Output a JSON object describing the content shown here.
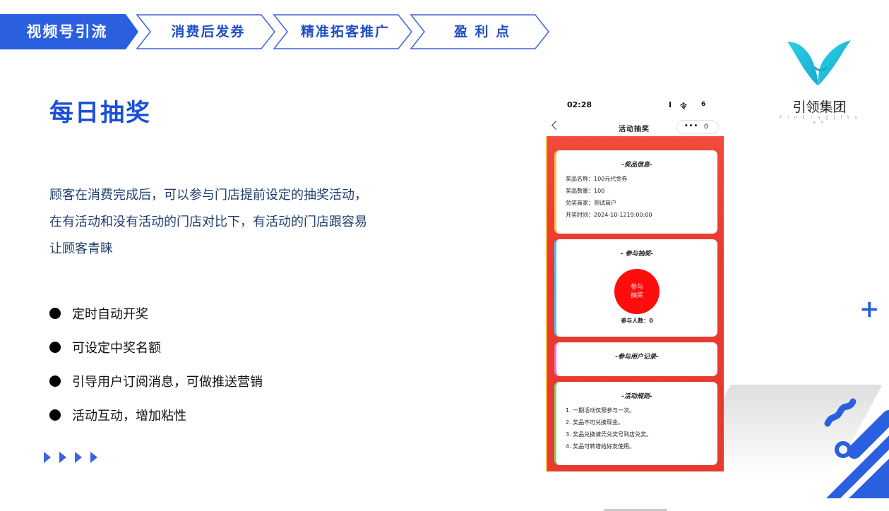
{
  "nav": {
    "steps": [
      {
        "label": "视频号引流",
        "active": true
      },
      {
        "label": "消费后发券",
        "active": false
      },
      {
        "label": "精准拓客推广",
        "active": false
      },
      {
        "label": "盈 利 点",
        "active": false
      }
    ]
  },
  "logo": {
    "name": "引领集团",
    "subtitle": "Y i n  L i n g  J i t u a n"
  },
  "content": {
    "title": "每日抽奖",
    "description": "顾客在消费完成后，可以参与门店提前设定的抽奖活动，在有活动和没有活动的门店对比下，有活动的门店跟容易让顾客青睐",
    "features": [
      "定时自动开奖",
      "可设定中奖名额",
      "引导用户订阅消息，可做推送营销",
      "活动互动，增加粘性"
    ]
  },
  "phone": {
    "status": {
      "time": "02:28",
      "battery": "6",
      "wifi": "令"
    },
    "appbar": {
      "title": "活动抽奖",
      "more": "•••",
      "close": "0"
    },
    "prize_card": {
      "title": "-奖品信息-",
      "lines": [
        "奖品名称：100元代金券",
        "奖品数量：100",
        "兑奖商家：测试商户",
        "开奖时间：2024-10-1219:00:00"
      ]
    },
    "join_card": {
      "title": "- 参与抽奖-",
      "button_line1": "参与",
      "button_line2": "抽奖",
      "participants": "参与人数：0"
    },
    "records_card": {
      "title": "-参与用户记录-"
    },
    "rules_card": {
      "title": "-活动规则-",
      "lines": [
        "1. 一期活动仅限参与一次。",
        "2. 奖品不可兑换现金。",
        "3. 奖品兑换请凭兑奖号到店兑奖。",
        "4. 奖品可转增给好友使用。"
      ]
    }
  },
  "colors": {
    "accent": "#1b4fd8",
    "nav_active": "#2a5fe0",
    "phone_bg": "#e9392e"
  }
}
